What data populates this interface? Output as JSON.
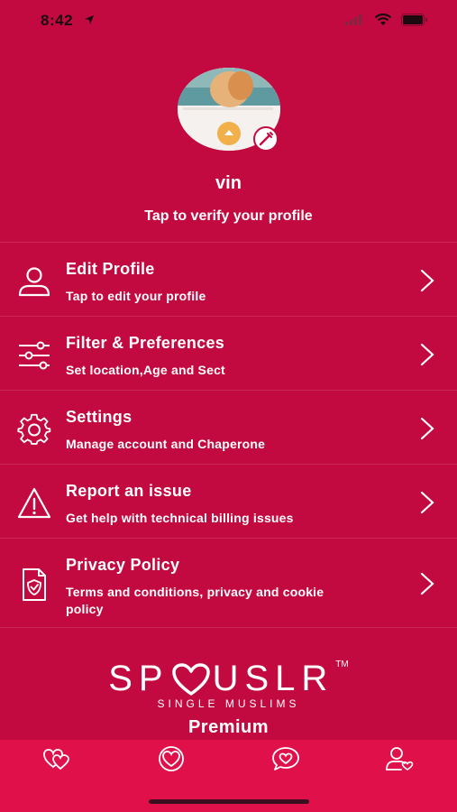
{
  "status_bar": {
    "time": "8:42"
  },
  "profile": {
    "username": "vin",
    "verify_prompt": "Tap to verify your profile"
  },
  "menu": [
    {
      "title": "Edit Profile",
      "subtitle": "Tap to edit your profile",
      "icon": "user-icon"
    },
    {
      "title": "Filter & Preferences",
      "subtitle": "Set location,Age and Sect",
      "icon": "sliders-icon"
    },
    {
      "title": "Settings",
      "subtitle": "Manage account and Chaperone",
      "icon": "gear-icon"
    },
    {
      "title": "Report an issue",
      "subtitle": "Get help with technical billing issues",
      "icon": "warning-icon"
    },
    {
      "title": "Privacy Policy",
      "subtitle": "Terms and conditions, privacy and cookie policy",
      "icon": "shield-document-icon"
    }
  ],
  "brand": {
    "logo_left": "SP",
    "logo_right": "USLR",
    "trademark": "TM",
    "tagline": "SINGLE MUSLIMS",
    "tier": "Premium"
  },
  "tab_bar": {
    "tabs": [
      {
        "icon": "hearts-icon"
      },
      {
        "icon": "heart-badge-icon"
      },
      {
        "icon": "heart-chat-icon"
      },
      {
        "icon": "profile-icon"
      }
    ]
  },
  "colors": {
    "background": "#c30a40",
    "tab_bar": "#e0104a",
    "text": "#ffffff"
  }
}
